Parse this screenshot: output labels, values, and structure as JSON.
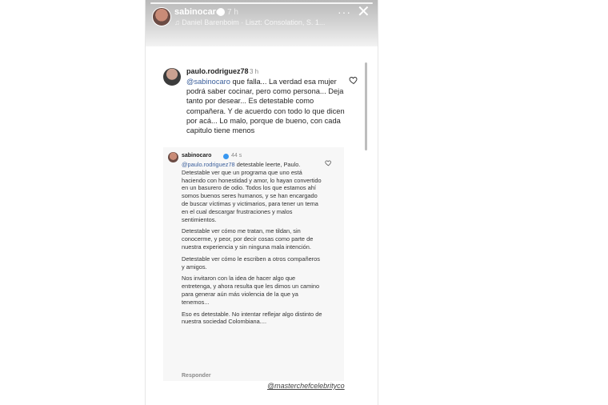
{
  "header": {
    "username": "sabinocaro",
    "time": "7 h",
    "music": "Daniel Barenboim · Liszt: Consolation, S. 1...",
    "close_label": "✕",
    "more_label": "···"
  },
  "comment": {
    "username": "paulo.rodriguez78",
    "time": "3 h",
    "mention": "@sabinocaro",
    "text": " que falla... La verdad esa mujer podrá saber cocinar, pero como persona... Deja tanto por desear... Es detestable como compañera. Y de acuerdo con todo lo que dicen por acá... Lo malo, porque de bueno, con cada capitulo tiene menos"
  },
  "reply": {
    "username": "sabinocaro",
    "time": "44 s",
    "mention": "@paulo.rodriguez78",
    "paragraphs": [
      " detestable leerte, Paulo. Detestable ver que un programa que uno está haciendo con honestidad y amor, lo hayan convertido en un basurero de odio. Todos los que estamos ahí somos buenos seres humanos, y se han encargado de buscar víctimas y victimarios, para tener un tema en el cual descargar frustraciones y malos sentimientos.",
      "Detestable ver cómo me tratan, me tildan, sin conocerme, y peor, por decir cosas como parte de nuestra experiencia y sin ninguna mala intención.",
      "Detestable ver cómo le escriben a otros compañeros y amigos.",
      "Nos invitaron con la idea de hacer algo que entretenga, y ahora resulta que les dimos un camino para generar aún más violencia de la que ya tenemos...",
      "Eso es detestable. No intentar reflejar algo distinto de nuestra sociedad Colombiana...."
    ],
    "reply_label": "Responder"
  },
  "credit": "@masterchefcelebrityco",
  "colors": {
    "mention": "#3b5f9b",
    "verified": "#3897f0"
  }
}
